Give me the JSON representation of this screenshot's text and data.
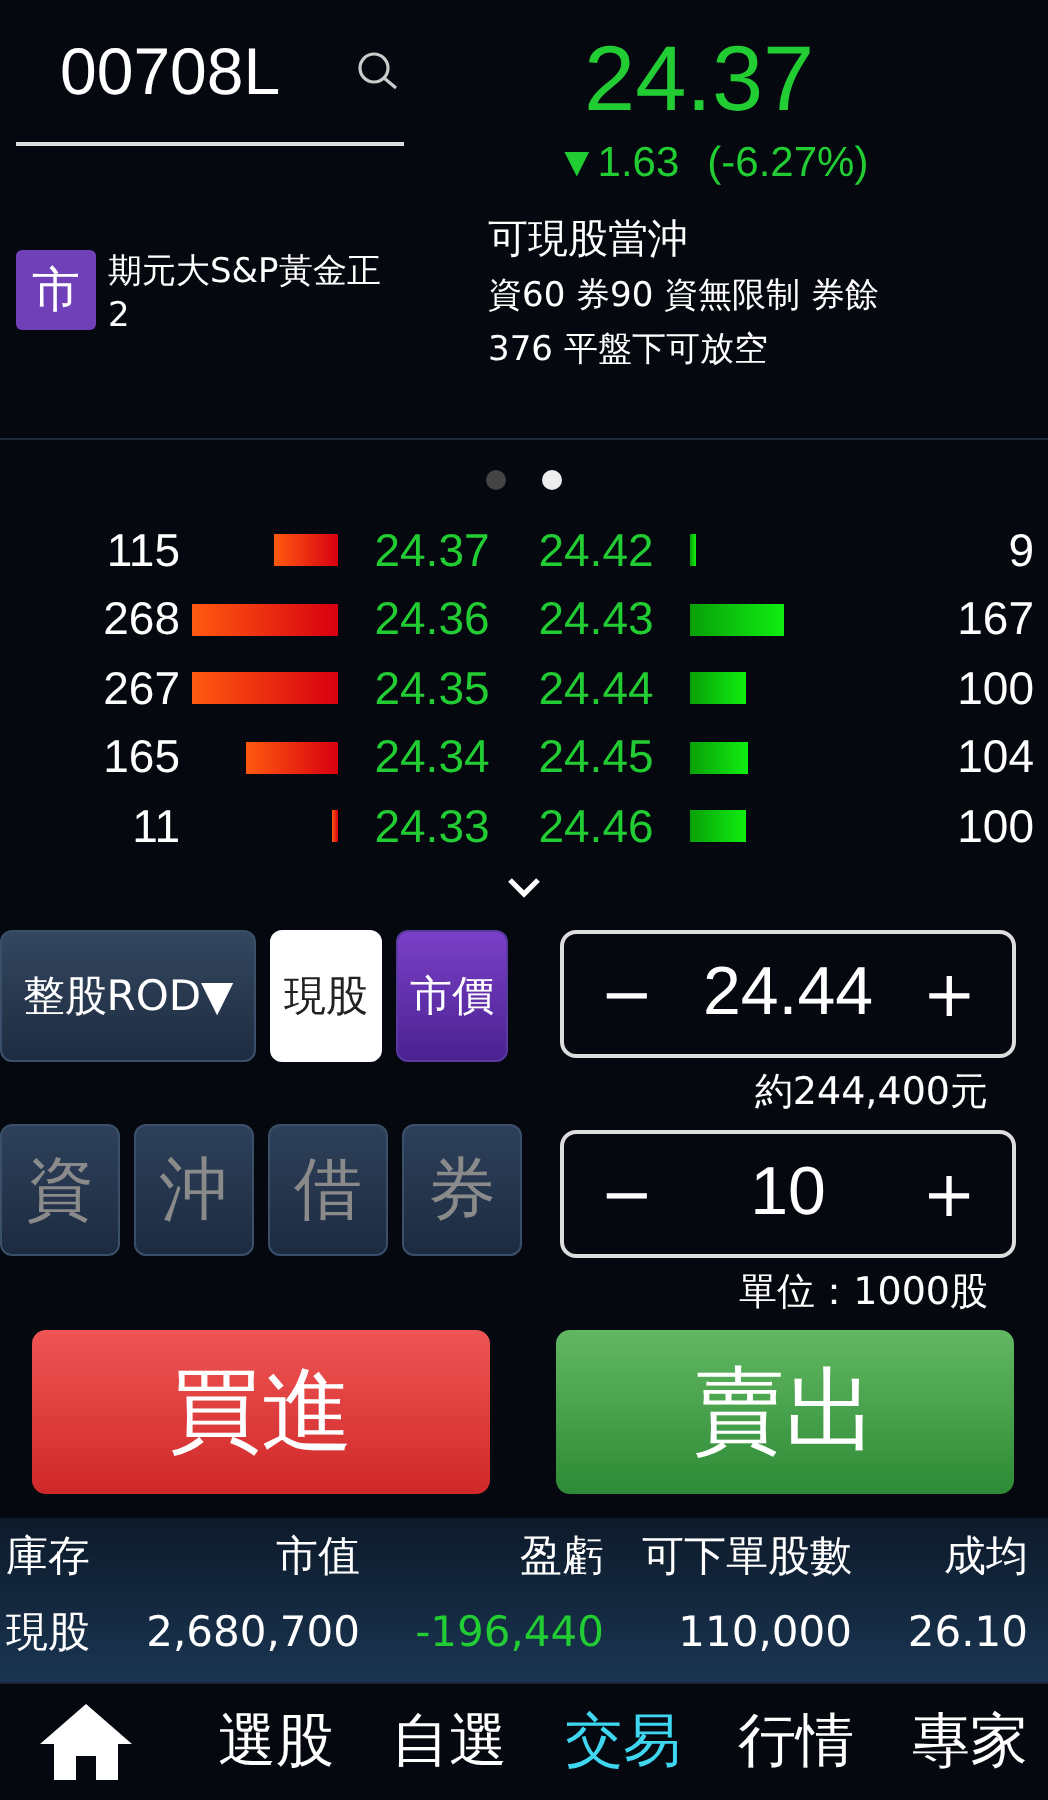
{
  "search": {
    "value": "00708L"
  },
  "quote": {
    "price": "24.37",
    "change": "▼1.63",
    "change_pct": "(-6.27%)"
  },
  "stock": {
    "badge": "市",
    "name": "期元大S&P黃金正2"
  },
  "trade_info": {
    "title": "可現股當沖",
    "detail": "資60 券90 資無限制 券餘376 平盤下可放空"
  },
  "pager": [
    {
      "selected": false
    },
    {
      "selected": true
    }
  ],
  "order_book": [
    {
      "bid_qty": "115",
      "bid": "24.37",
      "ask": "24.42",
      "ask_qty": "9"
    },
    {
      "bid_qty": "268",
      "bid": "24.36",
      "ask": "24.43",
      "ask_qty": "167"
    },
    {
      "bid_qty": "267",
      "bid": "24.35",
      "ask": "24.44",
      "ask_qty": "100"
    },
    {
      "bid_qty": "165",
      "bid": "24.34",
      "ask": "24.45",
      "ask_qty": "104"
    },
    {
      "bid_qty": "11",
      "bid": "24.33",
      "ask": "24.46",
      "ask_qty": "100"
    }
  ],
  "order_options": [
    {
      "label": "整股ROD▼",
      "kind": "dropdown",
      "selected": false
    },
    {
      "label": "現股",
      "kind": "toggle",
      "selected": true
    },
    {
      "label": "市價",
      "kind": "market",
      "selected": false
    }
  ],
  "credit_options": [
    {
      "label": "資",
      "disabled": true
    },
    {
      "label": "沖",
      "disabled": true
    },
    {
      "label": "借",
      "disabled": true
    },
    {
      "label": "券",
      "disabled": true
    }
  ],
  "price_stepper": {
    "minus": "−",
    "value": "24.44",
    "plus": "+",
    "note": "約244,400元"
  },
  "qty_stepper": {
    "minus": "−",
    "value": "10",
    "plus": "+",
    "note": "單位：1000股"
  },
  "buttons": [
    {
      "label": "買進",
      "kind": "buy"
    },
    {
      "label": "賣出",
      "kind": "sell"
    }
  ],
  "holdings": {
    "columns": [
      "庫存",
      "市值",
      "盈虧",
      "可下單股數",
      "成均"
    ],
    "row": [
      {
        "text": "現股",
        "kind": "plain"
      },
      {
        "text": "2,680,700",
        "kind": "plain"
      },
      {
        "text": "-196,440",
        "kind": "loss"
      },
      {
        "text": "110,000",
        "kind": "plain"
      },
      {
        "text": "26.10",
        "kind": "plain"
      }
    ]
  },
  "nav": [
    {
      "label": "選股",
      "selected": false
    },
    {
      "label": "自選",
      "selected": false
    },
    {
      "label": "交易",
      "selected": true
    },
    {
      "label": "行情",
      "selected": false
    },
    {
      "label": "專家",
      "selected": false
    }
  ]
}
